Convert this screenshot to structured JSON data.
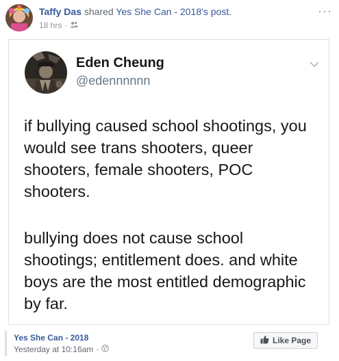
{
  "post_header": {
    "sharer_name": "Taffy Das",
    "shared_text": "shared",
    "source_page": "Yes She Can - 2018",
    "source_suffix": "'s post.",
    "time": "18 hrs",
    "separator": "·",
    "audience_icon": "friends-icon",
    "more_label": "···"
  },
  "tweet": {
    "author_name": "Eden Cheung",
    "author_handle": "@edennnnnn",
    "paragraphs": [
      "if bullying caused school shootings, you would see trans shooters, queer shooters, female shooters, POC shooters.",
      "bullying does not cause school shootings; entitlement does. and white boys are the most entitled demographic by far."
    ]
  },
  "footer": {
    "page_name": "Yes She Can - 2018",
    "timestamp": "Yesterday at 10:16am",
    "separator": "·",
    "audience_icon": "globe-icon",
    "like_label": "Like Page"
  },
  "colors": {
    "link": "#365899",
    "muted": "#90949c",
    "border": "#dddfe2",
    "tweet_text": "#14171a",
    "handle": "#657786"
  }
}
